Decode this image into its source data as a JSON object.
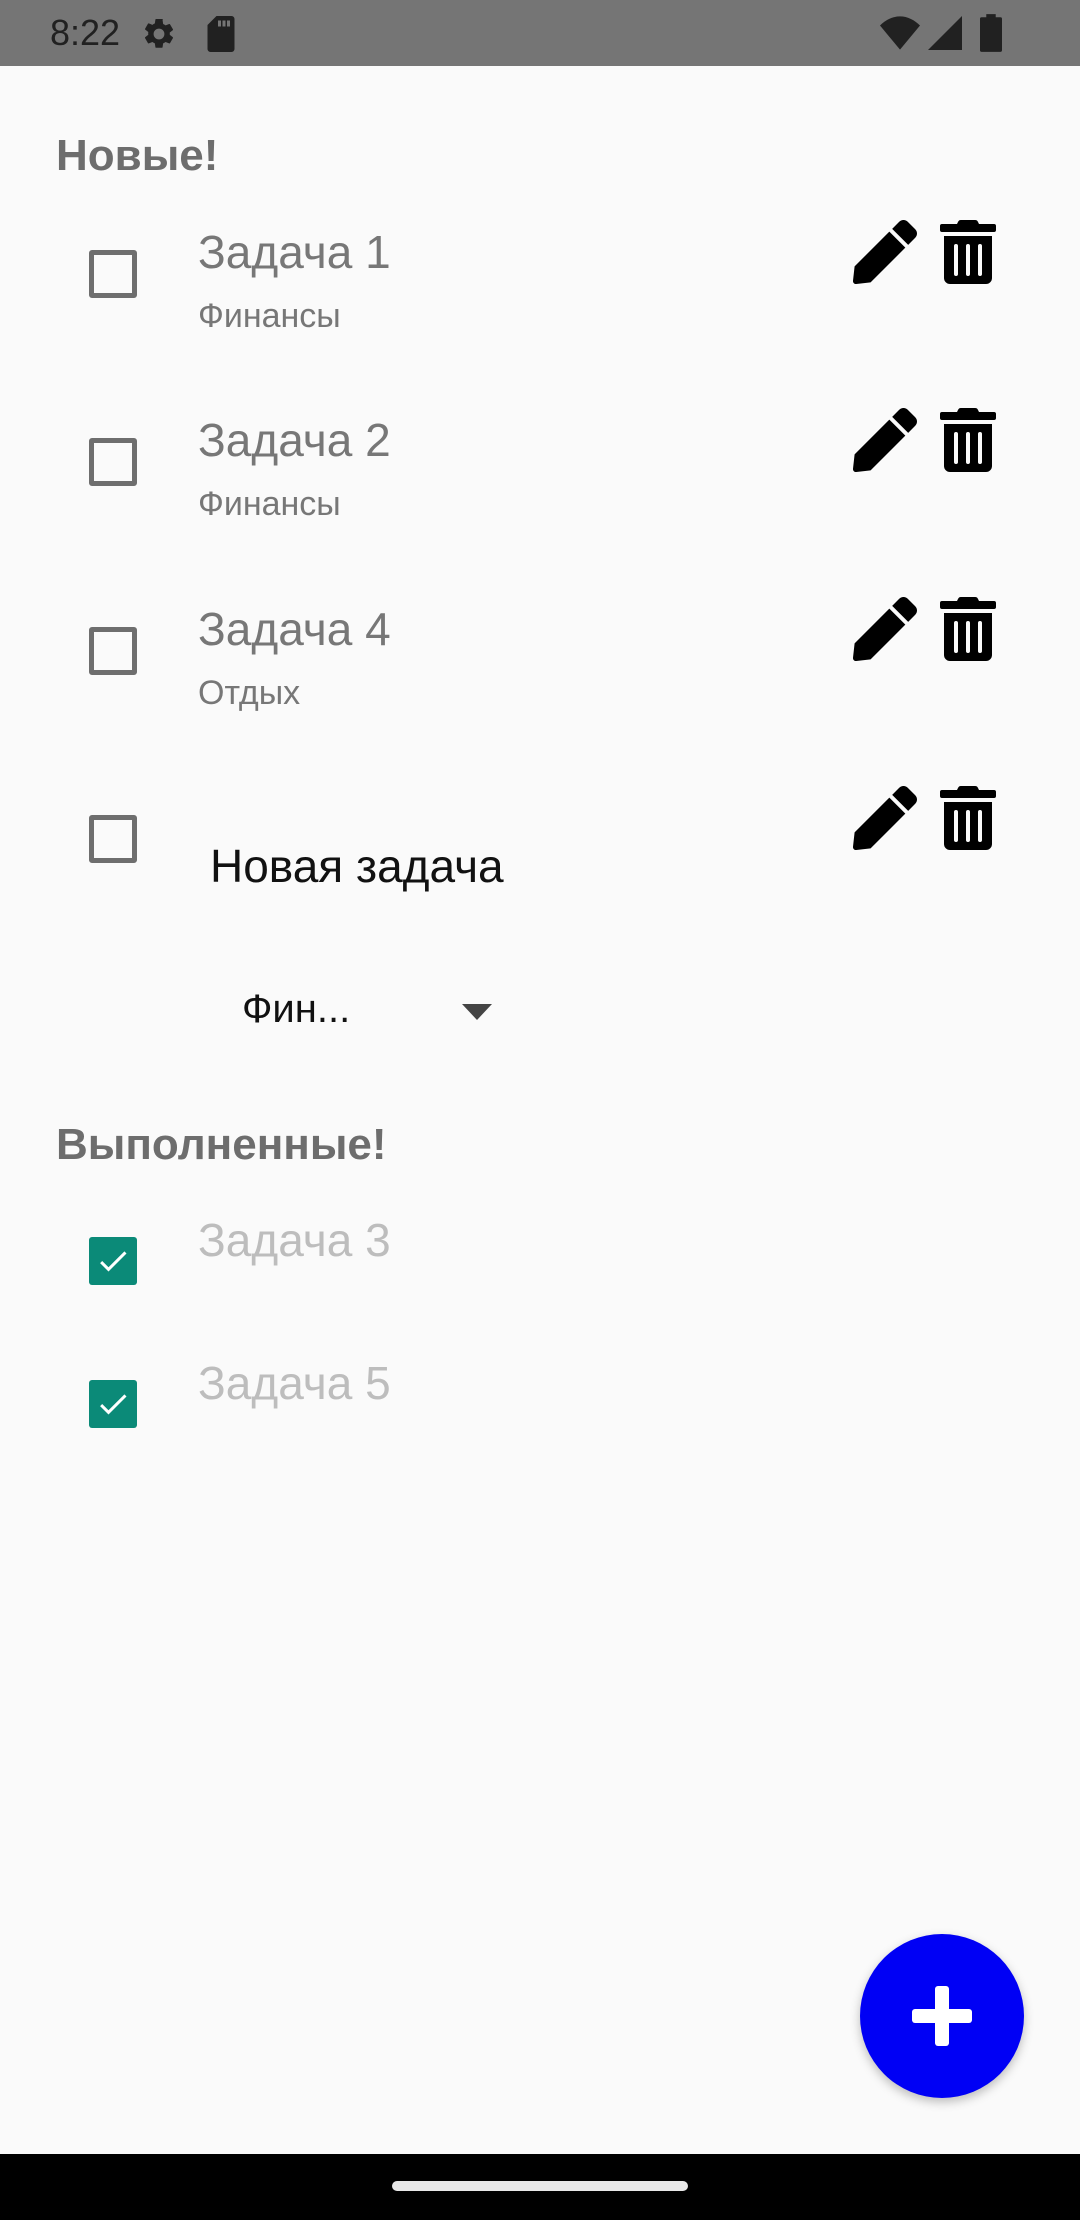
{
  "status_bar": {
    "time": "8:22",
    "icons": [
      "settings-icon",
      "sd-card-icon",
      "wifi-icon",
      "signal-icon",
      "battery-icon"
    ]
  },
  "sections": {
    "new_title": "Новые!",
    "done_title": "Выполненные!"
  },
  "new_tasks": [
    {
      "title": "Задача 1",
      "category": "Финансы",
      "checked": false
    },
    {
      "title": "Задача 2",
      "category": "Финансы",
      "checked": false
    },
    {
      "title": "Задача 4",
      "category": "Отдых",
      "checked": false
    }
  ],
  "new_task_editor": {
    "value": "Новая задача",
    "category_selected": "Фин...",
    "checked": false
  },
  "done_tasks": [
    {
      "title": "Задача 3",
      "checked": true
    },
    {
      "title": "Задача 5",
      "checked": true
    }
  ],
  "row_actions": [
    "edit-icon",
    "trash-icon"
  ],
  "fab": {
    "icon": "plus-icon"
  },
  "colors": {
    "accent": "#0000f5",
    "checkbox_checked": "#0b8a78",
    "status_bar": "#757575",
    "background": "#fafafa",
    "done_text": "#bdbdbd"
  }
}
